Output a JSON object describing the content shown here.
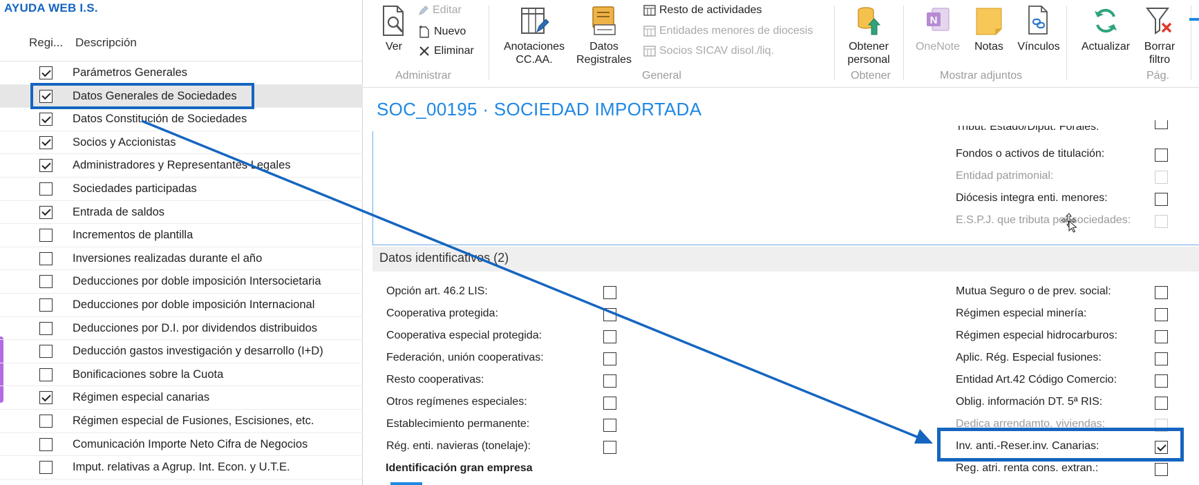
{
  "left_panel": {
    "title": "AYUDA WEB I.S.",
    "col_reg": "Regi...",
    "col_desc": "Descripción",
    "rows": [
      {
        "label": "Parámetros Generales",
        "checked": true
      },
      {
        "label": "Datos Generales de Sociedades",
        "checked": true,
        "selected": true
      },
      {
        "label": "Datos Constitución de Sociedades",
        "checked": true
      },
      {
        "label": "Socios y Accionistas",
        "checked": true
      },
      {
        "label": "Administradores y Representantes Legales",
        "checked": true
      },
      {
        "label": "Sociedades participadas",
        "checked": false
      },
      {
        "label": "Entrada de saldos",
        "checked": true
      },
      {
        "label": "Incrementos de plantilla",
        "checked": false
      },
      {
        "label": "Inversiones realizadas durante el año",
        "checked": false
      },
      {
        "label": "Deducciones por doble imposición Intersocietaria",
        "checked": false
      },
      {
        "label": "Deducciones por doble imposición Internacional",
        "checked": false
      },
      {
        "label": "Deducciones por D.I. por dividendos distribuidos",
        "checked": false
      },
      {
        "label": "Deducción gastos investigación y desarrollo (I+D)",
        "checked": false
      },
      {
        "label": "Bonificaciones sobre la Cuota",
        "checked": false
      },
      {
        "label": "Régimen especial canarias",
        "checked": true
      },
      {
        "label": "Régimen especial de Fusiones, Escisiones, etc.",
        "checked": false
      },
      {
        "label": "Comunicación Importe Neto Cifra de Negocios",
        "checked": false
      },
      {
        "label": "Imput. relativas a Agrup. Int. Econ. y U.T.E.",
        "checked": false
      }
    ]
  },
  "ribbon": {
    "ver": "Ver",
    "editar": "Editar",
    "nuevo": "Nuevo",
    "eliminar": "Eliminar",
    "anotaciones": "Anotaciones CC.AA.",
    "datos_registrales": "Datos Registrales",
    "resto_actividades": "Resto de actividades",
    "entidades_menores": "Entidades menores de diocesis",
    "socios_sicav": "Socios SICAV disol./liq.",
    "obtener_personal": "Obtener personal",
    "onenote": "OneNote",
    "notas": "Notas",
    "vinculos": "Vínculos",
    "actualizar": "Actualizar",
    "borrar_filtro": "Borrar filtro",
    "groups": {
      "administrar": "Administrar",
      "general": "General",
      "obtener": "Obtener",
      "mostrar_adjuntos": "Mostrar adjuntos",
      "pag": "Pág."
    }
  },
  "page_title": "SOC_00195 · SOCIEDAD IMPORTADA",
  "upper_fields": [
    {
      "label": "Tribut. Estado/Diput. Forales:",
      "checked": false,
      "disabled": false,
      "clipped": true
    },
    {
      "label": "Fondos o activos de titulación:",
      "checked": false,
      "disabled": false
    },
    {
      "label": "Entidad patrimonial:",
      "checked": false,
      "disabled": true
    },
    {
      "label": "Diócesis integra enti. menores:",
      "checked": false,
      "disabled": false
    },
    {
      "label": "E.S.P.J. que tributa por sociedades:",
      "checked": false,
      "disabled": true
    }
  ],
  "section": {
    "title": "Datos identificativos (2)",
    "left_fields": [
      {
        "label": "Opción art. 46.2 LIS:",
        "checked": false
      },
      {
        "label": "Cooperativa protegida:",
        "checked": false
      },
      {
        "label": "Cooperativa especial protegida:",
        "checked": false
      },
      {
        "label": "Federación, unión cooperativas:",
        "checked": false
      },
      {
        "label": "Resto cooperativas:",
        "checked": false
      },
      {
        "label": "Otros regímenes especiales:",
        "checked": false
      },
      {
        "label": "Establecimiento permanente:",
        "checked": false
      },
      {
        "label": "Rég. enti. navieras (tonelaje):",
        "checked": false
      }
    ],
    "right_fields": [
      {
        "label": "Mutua Seguro o de prev. social:",
        "checked": false,
        "disabled": false
      },
      {
        "label": "Régimen especial minería:",
        "checked": false,
        "disabled": false
      },
      {
        "label": "Régimen especial hidrocarburos:",
        "checked": false,
        "disabled": false
      },
      {
        "label": "Aplic. Rég. Especial fusiones:",
        "checked": false,
        "disabled": false
      },
      {
        "label": "Entidad Art.42 Código Comercio:",
        "checked": false,
        "disabled": false
      },
      {
        "label": "Oblig. información DT. 5ª RIS:",
        "checked": false,
        "disabled": false
      },
      {
        "label": "Dedica arrendamto. viviendas:",
        "checked": false,
        "disabled": true
      },
      {
        "label": "Inv. anti.-Reser.inv. Canarias:",
        "checked": true,
        "disabled": false
      },
      {
        "label": "Reg. atri. renta cons. extran.:",
        "checked": false,
        "disabled": false
      }
    ],
    "bold_title": "Identificación gran empresa"
  },
  "colors": {
    "accent": "#1565c0",
    "title": "#1e88e5",
    "purple": "#b36ae2"
  }
}
